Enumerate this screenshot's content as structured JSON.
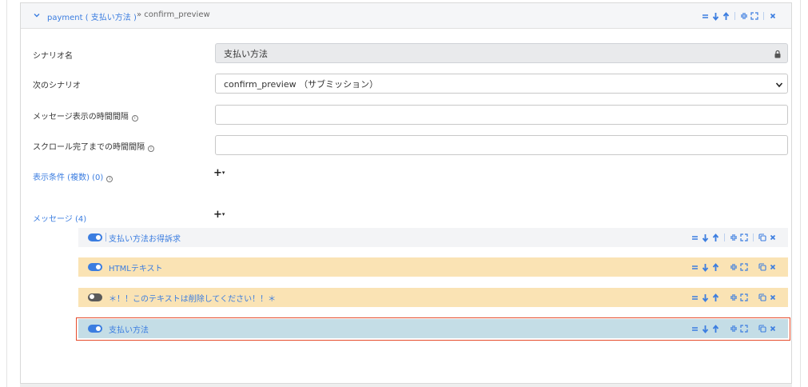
{
  "header": {
    "title": "payment ( 支払い方法 )",
    "sub": "» confirm_preview"
  },
  "form": {
    "scenario_name_label": "シナリオ名",
    "scenario_name_value": "支払い方法",
    "next_scenario_label": "次のシナリオ",
    "next_scenario_value": "confirm_preview （サブミッション）",
    "message_interval_label": "メッセージ表示の時間間隔",
    "scroll_interval_label": "スクロール完了までの時間間隔",
    "conditions_label": "表示条件 (複数) (0)",
    "messages_label": "メッセージ (4)",
    "info_glyph": "i",
    "add_glyph": "+",
    "add_caret": "▾"
  },
  "messages": [
    {
      "title": "支払い方法お得訴求",
      "enabled": true,
      "color": "#f3f4f6"
    },
    {
      "title": "HTMLテキスト",
      "enabled": true,
      "color": "#fae3b4"
    },
    {
      "title": "＊！！このテキストは削除してください！！＊",
      "enabled": false,
      "color": "#fae3b4"
    },
    {
      "title": "支払い方法",
      "enabled": true,
      "color": "#c4dde6",
      "selected": true
    }
  ],
  "colors": {
    "accent": "#3b7de0",
    "selected_outline": "#e54b2b"
  },
  "icons": [
    "chevron-down-icon",
    "menu-icon",
    "arrow-down-icon",
    "arrow-up-icon",
    "collapse-icon",
    "expand-icon",
    "copy-icon",
    "close-icon",
    "lock-icon",
    "info-icon",
    "add-icon",
    "toggle-icon"
  ]
}
